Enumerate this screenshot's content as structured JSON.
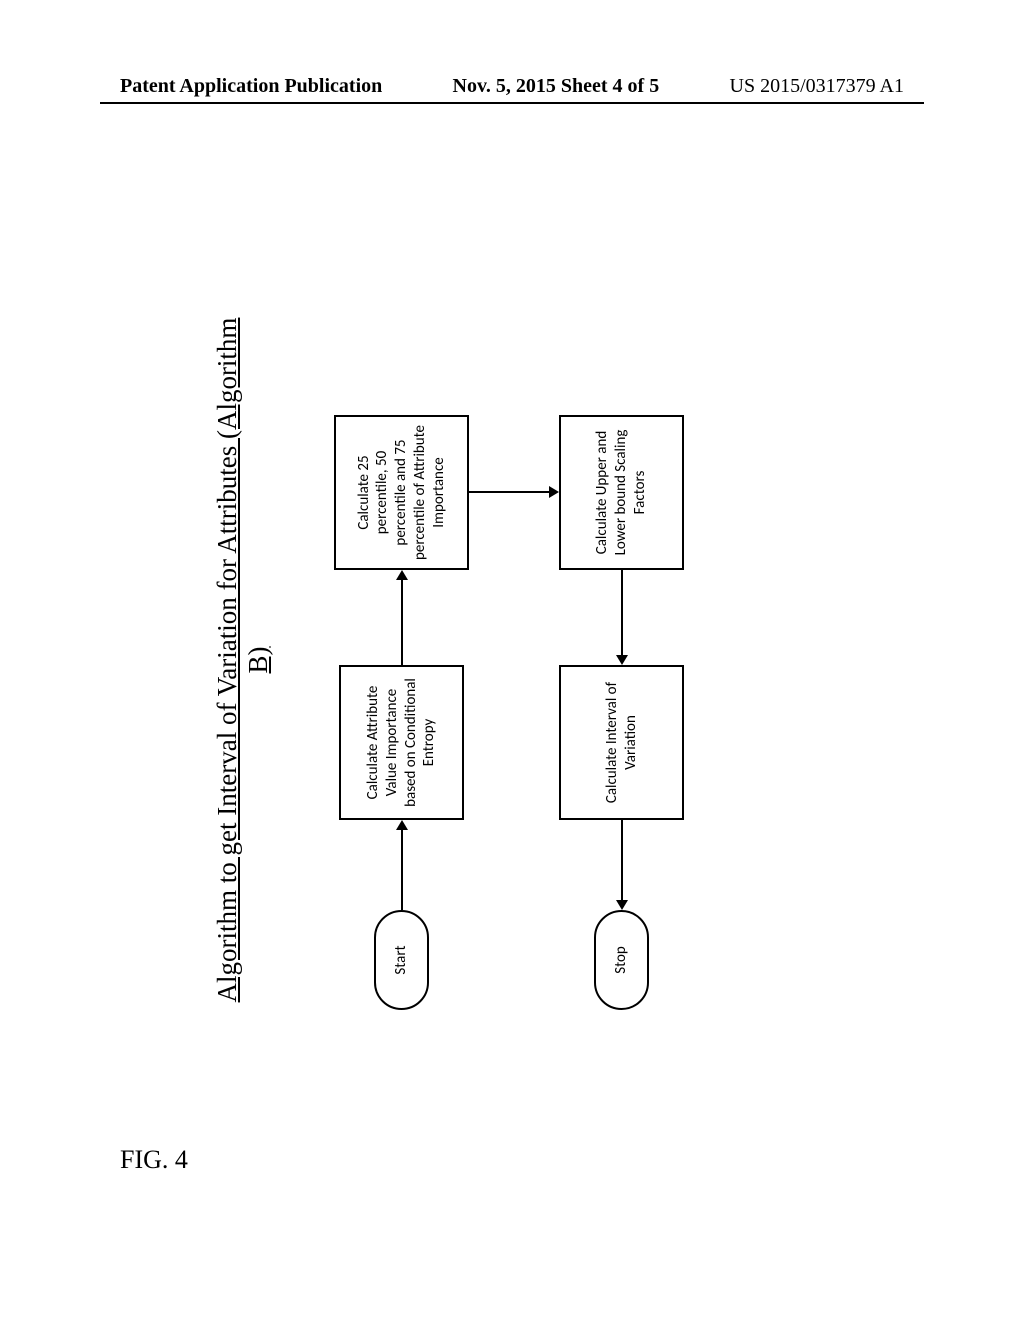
{
  "header": {
    "left": "Patent Application Publication",
    "center": "Nov. 5, 2015   Sheet 4 of 5",
    "right": "US 2015/0317379 A1"
  },
  "diagram": {
    "title": "Algorithm to get Interval of Variation for Attributes (Algorithm B)",
    "nodes": {
      "start": "Start",
      "calc_attribute": "Calculate Attribute Value Importance based on Conditional Entropy",
      "calc_percentile": "Calculate 25 percentile, 50 percentile and 75 percentile of Attribute Importance",
      "calc_bounds": "Calculate Upper and Lower bound Scaling Factors",
      "calc_interval": "Calculate Interval of Variation",
      "stop": "Stop"
    }
  },
  "figure_label": "FIG. 4"
}
